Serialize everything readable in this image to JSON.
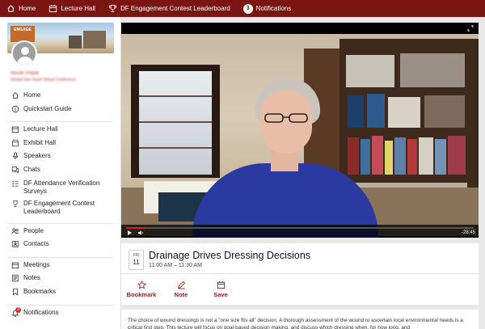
{
  "topbar": {
    "home": "Home",
    "lecture_hall": "Lecture Hall",
    "leaderboard": "DF Engagement Contest Leaderboard",
    "notifications": "Notifications",
    "notif_count": "3"
  },
  "profile": {
    "banner_logo": "ENGAGE",
    "name": "Nicole Pieper",
    "org": "Global Onn Seed Virtual Conference"
  },
  "sidebar": {
    "home": "Home",
    "quickstart": "Quickstart Guide",
    "lecture_hall": "Lecture Hall",
    "exhibit_hall": "Exhibit Hall",
    "speakers": "Speakers",
    "chats": "Chats",
    "attendance_1": "DF Attendance Verification",
    "attendance_2": "Surveys",
    "leaderboard_1": "DF Engagement Contest",
    "leaderboard_2": "Leaderboard",
    "people": "People",
    "contacts": "Contacts",
    "meetings": "Meetings",
    "notes": "Notes",
    "bookmarks": "Bookmarks",
    "notifications": "Notifications",
    "notif_count": "3"
  },
  "video": {
    "time_remaining": "-28:45",
    "progress": 0.06
  },
  "session": {
    "day": "FRI",
    "date": "11",
    "title": "Drainage Drives Dressing Decisions",
    "time": "11:00 AM – 11:30 AM",
    "bookmark": "Bookmark",
    "note": "Note",
    "save": "Save"
  },
  "description": {
    "text": "The choice of wound dressings is not a \"one size fits all\" decision. A thorough assessment of the wound to ascertain local environmental needs is a critical first step. This lecture will focus on goal-based decision making, and discuss which dressing when, for how long, and"
  },
  "colors": {
    "brand": "#7a1512",
    "accent": "#8b1f1a"
  }
}
